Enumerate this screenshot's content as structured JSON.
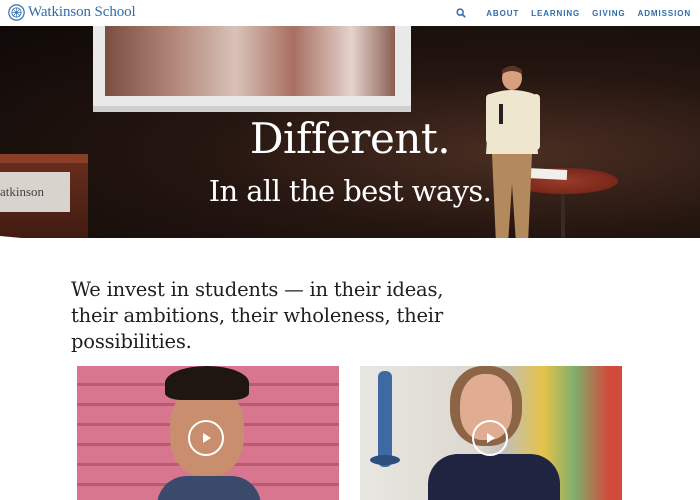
{
  "header": {
    "logo_text": "Watkinson School",
    "nav": {
      "search_icon": "search-icon",
      "items": [
        "ABOUT",
        "LEARNING",
        "GIVING",
        "ADMISSION"
      ]
    }
  },
  "hero": {
    "title": "Different.",
    "subtitle": "In all the best ways.",
    "podium_sign": "atkinson"
  },
  "intro": {
    "text": "We invest in students — in their ideas, their ambitions, their wholeness, their possibilities."
  },
  "videos": [
    {
      "icon": "play-icon"
    },
    {
      "icon": "play-icon"
    }
  ],
  "colors": {
    "brand_blue": "#2f6da8",
    "text_dark": "#1f1f1f",
    "white": "#ffffff"
  }
}
